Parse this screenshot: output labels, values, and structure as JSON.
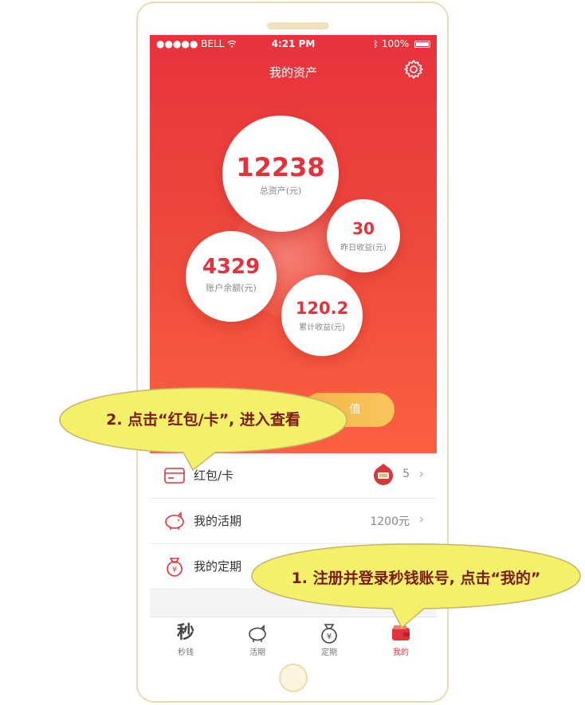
{
  "status_bar": {
    "carrier": "●●●●● BELL",
    "time": "4:21 PM",
    "battery": "100%"
  },
  "header": {
    "title": "我的资产"
  },
  "assets": {
    "total": {
      "value": "12238",
      "label": "总资产(元)"
    },
    "yesterday": {
      "value": "30",
      "label": "昨日收益(元)"
    },
    "balance": {
      "value": "4329",
      "label": "账户余额(元)"
    },
    "cumulative": {
      "value": "120.2",
      "label": "累计收益(元)"
    }
  },
  "action_button": {
    "label": "值"
  },
  "list": [
    {
      "label": "红包/卡",
      "value": "5",
      "icon": "card-icon"
    },
    {
      "label": "我的活期",
      "value": "1200元",
      "icon": "piggy-bank-icon"
    },
    {
      "label": "我的定期",
      "value": "",
      "icon": "money-bag-icon"
    }
  ],
  "tabbar": [
    {
      "label": "秒钱",
      "icon": "miao-icon",
      "glyph": "秒"
    },
    {
      "label": "活期",
      "icon": "piggy-bank-icon"
    },
    {
      "label": "定期",
      "icon": "money-bag-icon"
    },
    {
      "label": "我的",
      "icon": "wallet-icon"
    }
  ],
  "callouts": {
    "step1": "1. 注册并登录秒钱账号, 点击“我的”",
    "step2": "2. 点击“红包/卡”, 进入查看"
  },
  "colors": {
    "accent": "#e3323b",
    "callout_fill": "#f3f06a",
    "callout_stroke": "#c9b36a"
  }
}
